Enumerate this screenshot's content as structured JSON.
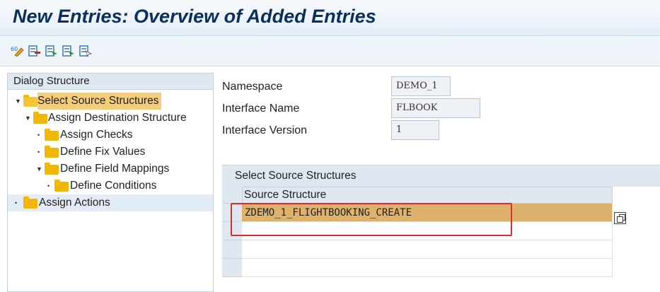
{
  "title": "New Entries: Overview of Added Entries",
  "toolbar": {
    "icons": [
      "display-change-icon",
      "delete-icon",
      "select-all-icon",
      "select-block-icon",
      "deselect-all-icon"
    ]
  },
  "dialog_structure": {
    "heading": "Dialog Structure",
    "items": [
      {
        "label": "Select Source Structures",
        "selected": true
      },
      {
        "label": "Assign Destination Structure"
      },
      {
        "label": "Assign Checks"
      },
      {
        "label": "Define Fix Values"
      },
      {
        "label": "Define Field Mappings"
      },
      {
        "label": "Define Conditions"
      },
      {
        "label": "Assign Actions"
      }
    ]
  },
  "form": {
    "namespace_label": "Namespace",
    "namespace_value": "DEMO_1",
    "interface_name_label": "Interface Name",
    "interface_name_value": "FLBOOK",
    "interface_version_label": "Interface Version",
    "interface_version_value": "1"
  },
  "table": {
    "title": "Select Source Structures",
    "column_header": "Source Structure",
    "rows": [
      "ZDEMO_1_FLIGHTBOOKING_CREATE",
      "",
      "",
      ""
    ]
  },
  "colors": {
    "selection": "#f5cd7a",
    "active_row": "#ddb26c",
    "highlight_border": "#e12a2a",
    "folder": "#f2b705",
    "title_text": "#0b2f5b"
  }
}
